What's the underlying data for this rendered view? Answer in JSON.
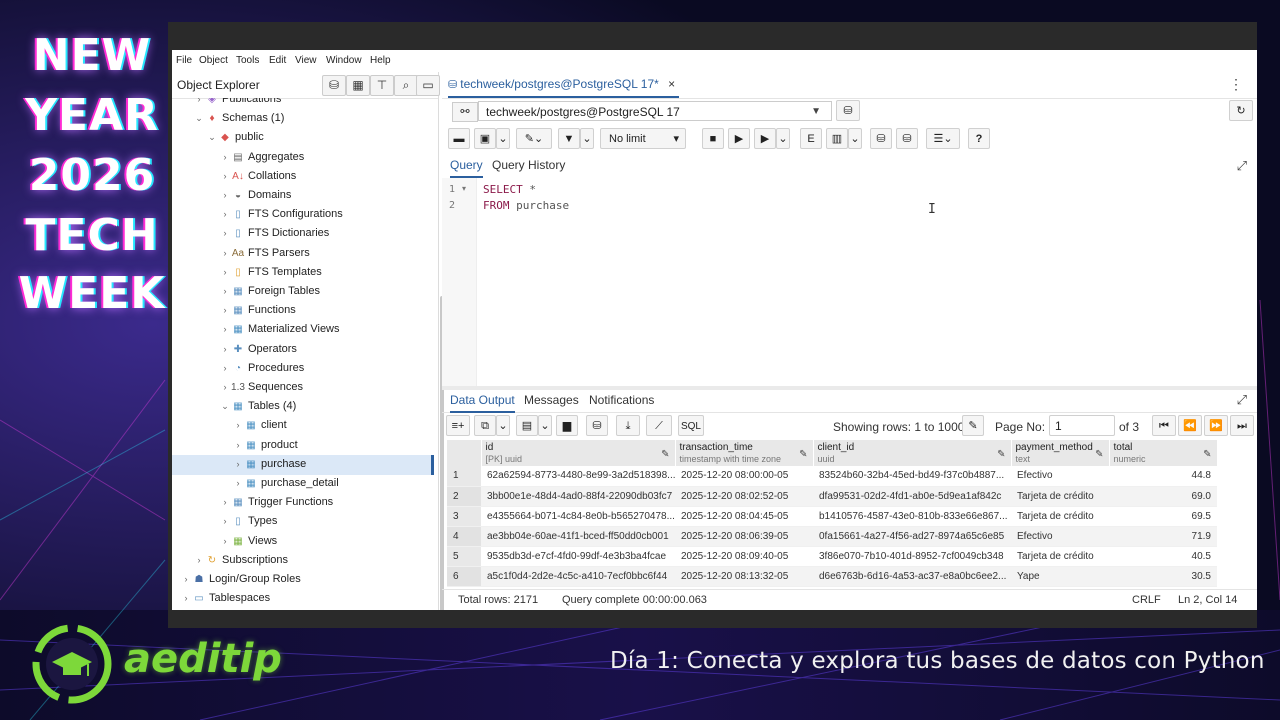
{
  "overlay": {
    "title_words": [
      "NEW",
      "YEAR",
      "2026",
      "TECH",
      "WEEK"
    ],
    "brand": "aeditip",
    "subtitle": "Día 1: Conecta y explora tus bases de datos con Python"
  },
  "menu": [
    "File",
    "Object",
    "Tools",
    "Edit",
    "View",
    "Window",
    "Help"
  ],
  "object_explorer": {
    "title": "Object Explorer",
    "tree": [
      {
        "label": "Publications",
        "depth": 3,
        "icon": "publications-icon"
      },
      {
        "label": "Schemas (1)",
        "depth": 3,
        "icon": "schemas-icon",
        "open": true
      },
      {
        "label": "public",
        "depth": 4,
        "icon": "schema-icon",
        "open": true
      },
      {
        "label": "Aggregates",
        "depth": 5,
        "icon": "aggregates-icon"
      },
      {
        "label": "Collations",
        "depth": 5,
        "icon": "collations-icon"
      },
      {
        "label": "Domains",
        "depth": 5,
        "icon": "domains-icon"
      },
      {
        "label": "FTS Configurations",
        "depth": 5,
        "icon": "fts-configurations-icon"
      },
      {
        "label": "FTS Dictionaries",
        "depth": 5,
        "icon": "fts-dictionaries-icon"
      },
      {
        "label": "FTS Parsers",
        "depth": 5,
        "icon": "fts-parsers-icon"
      },
      {
        "label": "FTS Templates",
        "depth": 5,
        "icon": "fts-templates-icon"
      },
      {
        "label": "Foreign Tables",
        "depth": 5,
        "icon": "foreign-tables-icon"
      },
      {
        "label": "Functions",
        "depth": 5,
        "icon": "functions-icon"
      },
      {
        "label": "Materialized Views",
        "depth": 5,
        "icon": "materialized-views-icon"
      },
      {
        "label": "Operators",
        "depth": 5,
        "icon": "operators-icon"
      },
      {
        "label": "Procedures",
        "depth": 5,
        "icon": "procedures-icon"
      },
      {
        "label": "Sequences",
        "depth": 5,
        "icon": "sequences-icon"
      },
      {
        "label": "Tables (4)",
        "depth": 5,
        "icon": "tables-icon",
        "open": true
      },
      {
        "label": "client",
        "depth": 6,
        "icon": "table-icon"
      },
      {
        "label": "product",
        "depth": 6,
        "icon": "table-icon"
      },
      {
        "label": "purchase",
        "depth": 6,
        "icon": "table-icon",
        "selected": true
      },
      {
        "label": "purchase_detail",
        "depth": 6,
        "icon": "table-icon"
      },
      {
        "label": "Trigger Functions",
        "depth": 5,
        "icon": "trigger-functions-icon"
      },
      {
        "label": "Types",
        "depth": 5,
        "icon": "types-icon"
      },
      {
        "label": "Views",
        "depth": 5,
        "icon": "views-icon"
      },
      {
        "label": "Subscriptions",
        "depth": 3,
        "icon": "subscriptions-icon"
      },
      {
        "label": "Login/Group Roles",
        "depth": 2,
        "icon": "roles-icon"
      },
      {
        "label": "Tablespaces",
        "depth": 2,
        "icon": "tablespaces-icon"
      }
    ]
  },
  "query_tab": {
    "label": "techweek/postgres@PostgreSQL 17*",
    "close": "×"
  },
  "connection": {
    "value": "techweek/postgres@PostgreSQL 17"
  },
  "toolbar": {
    "limit": "No limit"
  },
  "editor_tabs": [
    "Query",
    "Query History"
  ],
  "editor": {
    "lines": [
      {
        "n": "1",
        "kw": "SELECT",
        "rest": " *"
      },
      {
        "n": "2",
        "kw": "FROM",
        "rest": " purchase"
      }
    ]
  },
  "output_tabs": [
    "Data Output",
    "Messages",
    "Notifications"
  ],
  "output_toolbar": {
    "sql_label": "SQL",
    "showing": "Showing rows: 1 to 1000",
    "page_label": "Page No:",
    "page_value": "1",
    "of_pages": "of 3"
  },
  "grid": {
    "columns": [
      {
        "name": "id",
        "type": "[PK] uuid"
      },
      {
        "name": "transaction_time",
        "type": "timestamp with time zone"
      },
      {
        "name": "client_id",
        "type": "uuid"
      },
      {
        "name": "payment_method",
        "type": "text"
      },
      {
        "name": "total",
        "type": "numeric"
      }
    ],
    "rows": [
      [
        "1",
        "62a62594-8773-4480-8e99-3a2d518398...",
        "2025-12-20 08:00:00-05",
        "83524b60-32b4-45ed-bd49-f37c0b4887...",
        "Efectivo",
        "44.8"
      ],
      [
        "2",
        "3bb00e1e-48d4-4ad0-88f4-22090db03fc7",
        "2025-12-20 08:02:52-05",
        "dfa99531-02d2-4fd1-ab0e-5d9ea1af842c",
        "Tarjeta de crédito",
        "69.0"
      ],
      [
        "3",
        "e4355664-b071-4c84-8e0b-b565270478...",
        "2025-12-20 08:04:45-05",
        "b1410576-4587-43e0-810b-833e66e867...",
        "Tarjeta de crédito",
        "69.5"
      ],
      [
        "4",
        "ae3bb04e-60ae-41f1-bced-ff50dd0cb001",
        "2025-12-20 08:06:39-05",
        "0fa15661-4a27-4f56-ad27-8974a65c6e85",
        "Efectivo",
        "71.9"
      ],
      [
        "5",
        "9535db3d-e7cf-4fd0-99df-4e3b3ba4fcae",
        "2025-12-20 08:09:40-05",
        "3f86e070-7b10-401d-8952-7cf0049cb348",
        "Tarjeta de crédito",
        "40.5"
      ],
      [
        "6",
        "a5c1f0d4-2d2e-4c5c-a410-7ecf0bbc6f44",
        "2025-12-20 08:13:32-05",
        "d6e6763b-6d16-4a53-ac37-e8a0bc6ee2...",
        "Yape",
        "30.5"
      ]
    ]
  },
  "status": {
    "total_rows": "Total rows: 2171",
    "query_complete": "Query complete 00:00:00.063",
    "eol": "CRLF",
    "position": "Ln 2, Col 14"
  },
  "colors": {
    "accent": "#2b5f9e",
    "brand_green": "#7dd83a",
    "keyword": "#8b1a4a"
  }
}
